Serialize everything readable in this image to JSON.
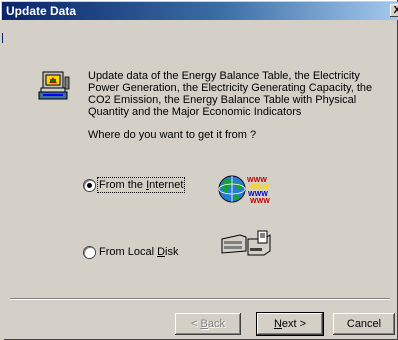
{
  "window": {
    "title": "Update Data",
    "close_glyph": "X"
  },
  "info": {
    "icon": "update-data-icon",
    "description": "Update data of the Energy Balance Table, the Electricity Power Generation, the Electricity Generating Capacity, the CO2 Emission, the Energy Balance Table with Physical Quantity and the Major Economic Indicators"
  },
  "question": "Where do you want to get it from ?",
  "options": [
    {
      "label_pre": "From the ",
      "label_key": "I",
      "label_post": "nternet",
      "selected": true,
      "icon": "internet-globe-icon"
    },
    {
      "label_pre": "From Local ",
      "label_key": "D",
      "label_post": "isk",
      "selected": false,
      "icon": "local-disk-icon"
    }
  ],
  "buttons": {
    "back": {
      "pre": "< ",
      "key": "B",
      "post": "ack",
      "enabled": false
    },
    "next": {
      "pre": "",
      "key": "N",
      "post": "ext >",
      "enabled": true
    },
    "cancel": {
      "label": "Cancel",
      "enabled": true
    }
  }
}
